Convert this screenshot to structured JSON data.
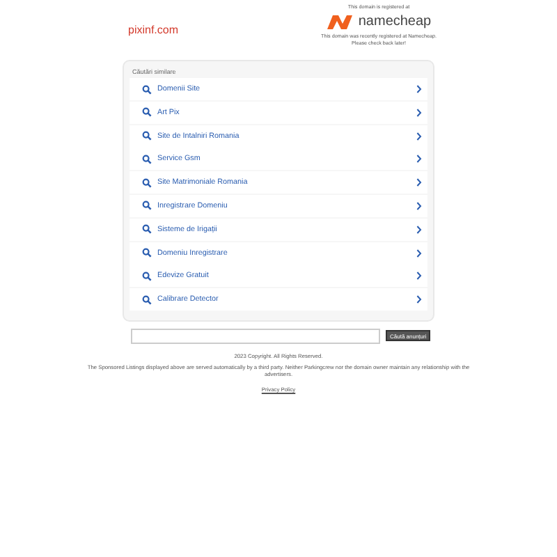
{
  "domain": "pixinf.com",
  "registrar": {
    "top_note": "This domain is registered at",
    "logo_text": "namecheap",
    "bottom_note": "This domain was recently registered at Namecheap.",
    "bottom_note_2": "Please check back later!"
  },
  "related": {
    "heading": "Căutări similare",
    "items": [
      {
        "label": "Domenii Site"
      },
      {
        "label": "Art Pix"
      },
      {
        "label": "Site de Intalniri Romania"
      },
      {
        "label": "Service Gsm"
      },
      {
        "label": "Site Matrimoniale Romania"
      },
      {
        "label": "Inregistrare Domeniu"
      },
      {
        "label": "Sisteme de Irigații"
      },
      {
        "label": "Domeniu Inregistrare"
      },
      {
        "label": "Edevize Gratuit"
      },
      {
        "label": "Calibrare Detector"
      }
    ]
  },
  "search": {
    "button": "Căută anunțuri"
  },
  "footer": {
    "copyright": "2023 Copyright. All Rights Reserved.",
    "disclaimer": "The Sponsored Listings displayed above are served automatically by a third party. Neither Parkingcrew nor the domain owner maintain any relationship with the advertisers.",
    "privacy": "Privacy Policy"
  }
}
